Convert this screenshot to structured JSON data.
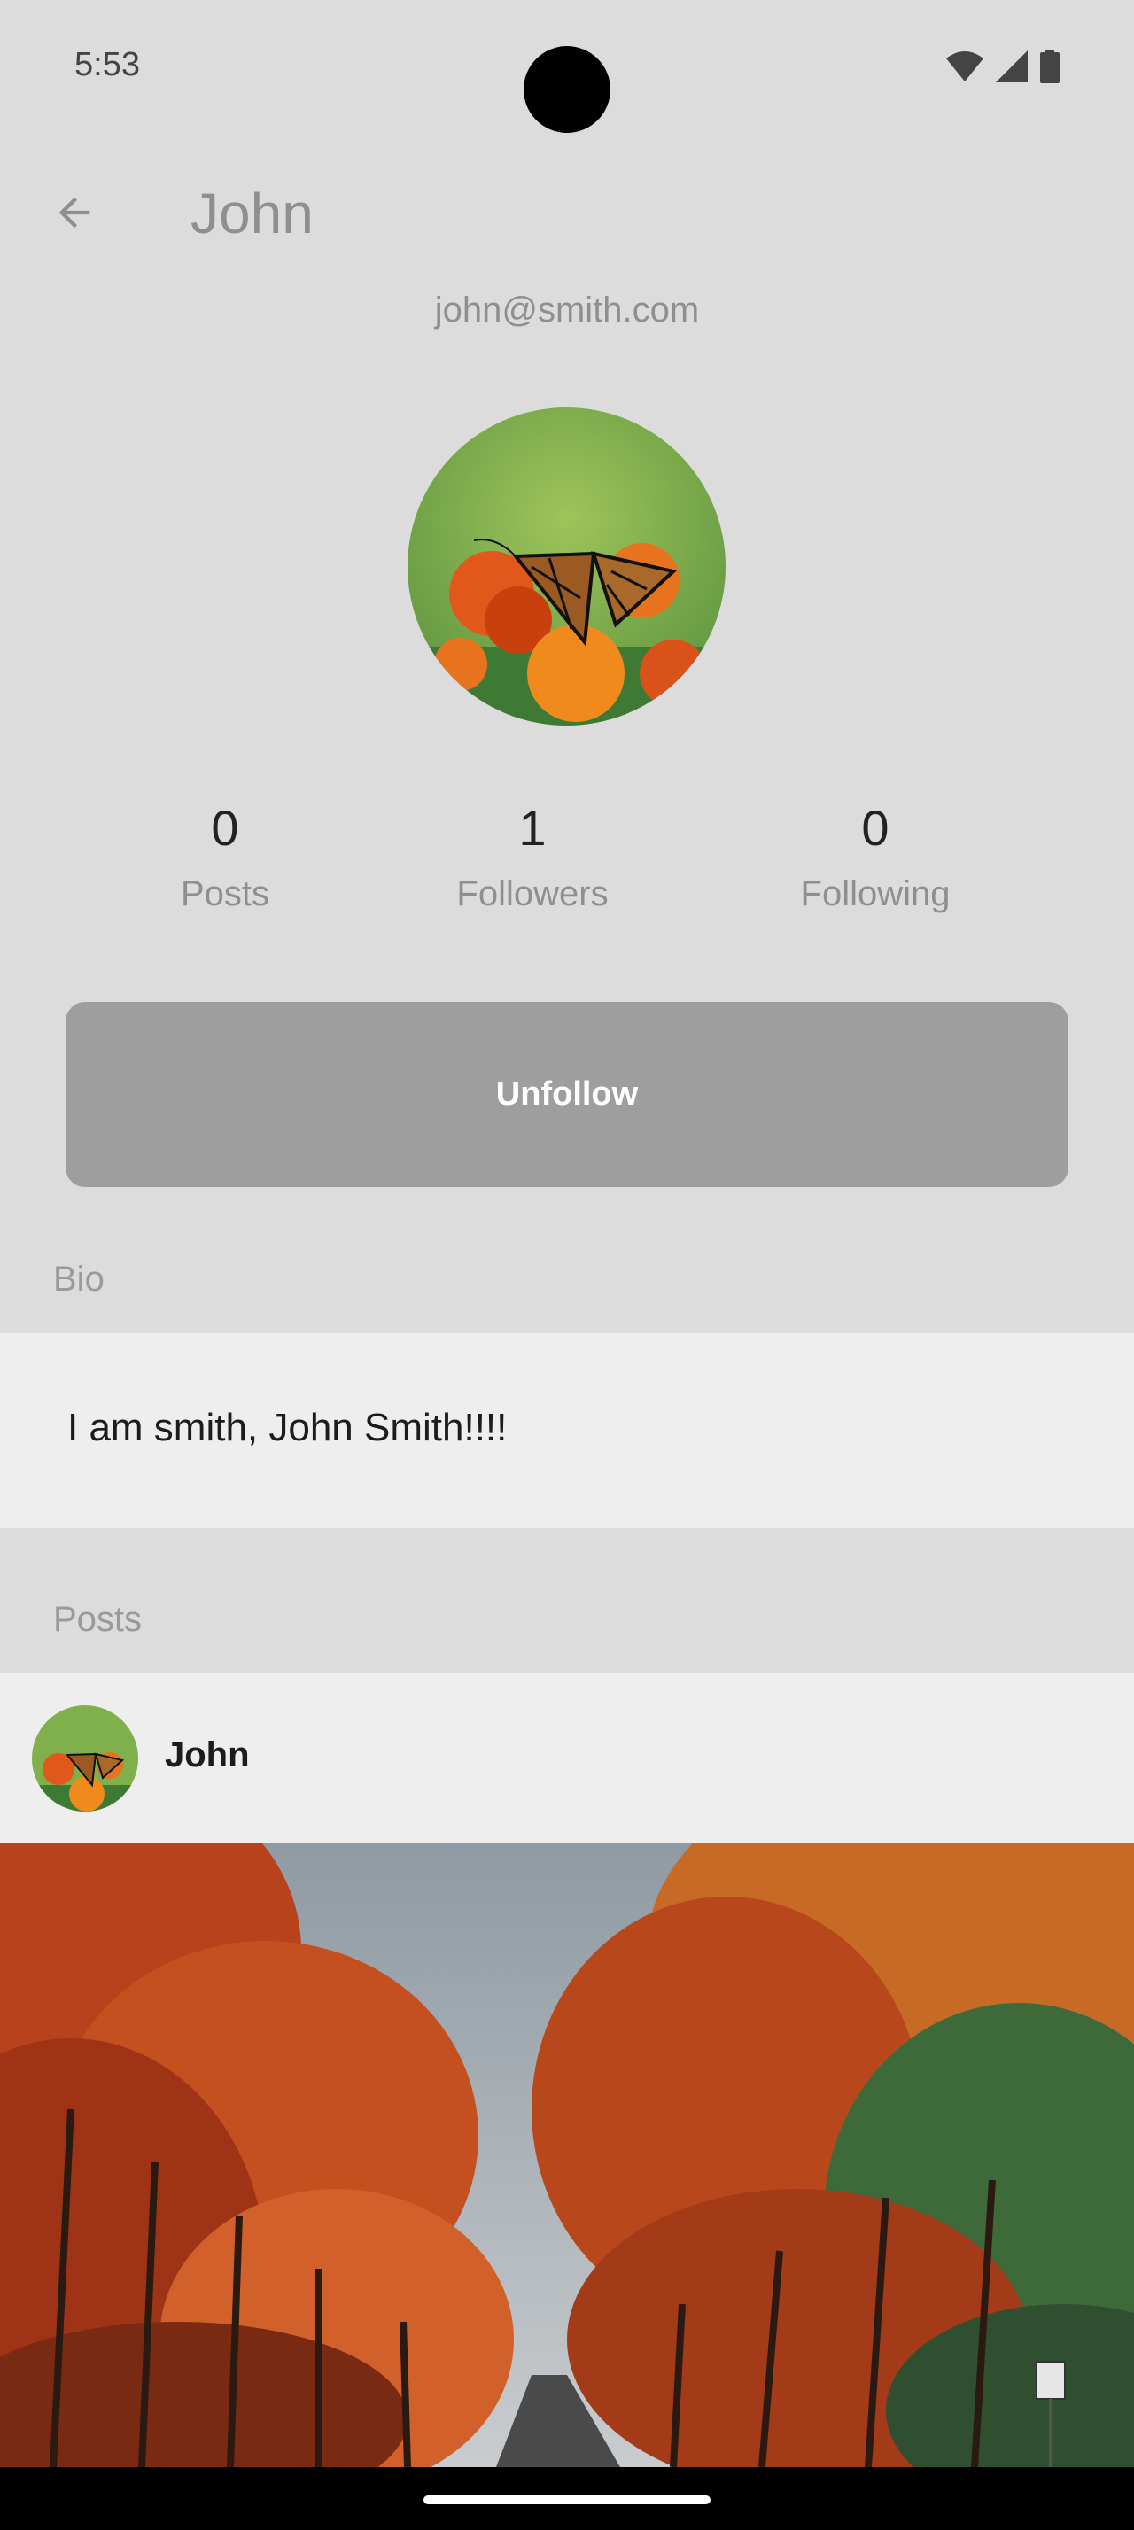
{
  "status_bar": {
    "time": "5:53",
    "icons": [
      "wifi-icon",
      "signal-icon",
      "battery-icon"
    ]
  },
  "app_bar": {
    "back_icon": "arrow-back-icon",
    "title": "John"
  },
  "profile": {
    "email": "john@smith.com",
    "avatar": "butterfly-on-marigold-photo",
    "stats": [
      {
        "value": "0",
        "label": "Posts"
      },
      {
        "value": "1",
        "label": "Followers"
      },
      {
        "value": "0",
        "label": "Following"
      }
    ],
    "unfollow_label": "Unfollow"
  },
  "bio": {
    "heading": "Bio",
    "text": "I am smith, John Smith!!!!"
  },
  "posts": {
    "heading": "Posts",
    "items": [
      {
        "author": "John",
        "image": "autumn-tree-lined-road-photo"
      }
    ]
  },
  "colors": {
    "background": "#dcdcdc",
    "card": "#eeeeee",
    "button": "#9e9e9e",
    "muted_text": "#8f8f8f"
  }
}
